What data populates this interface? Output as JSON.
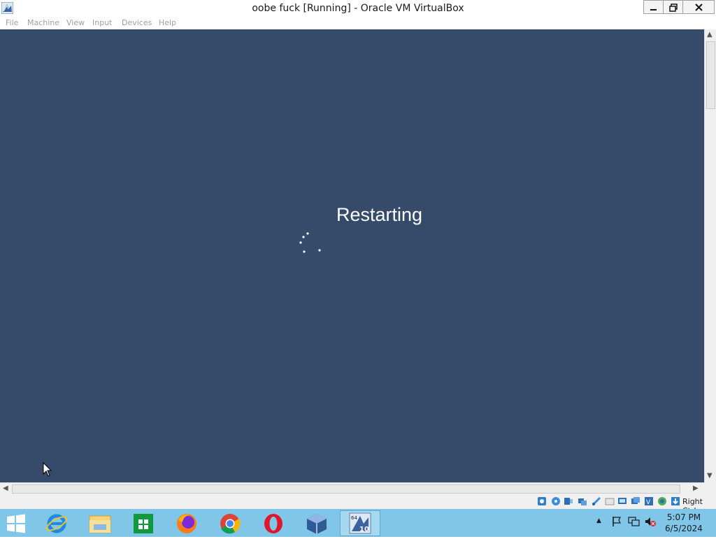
{
  "window": {
    "title": "oobe fuck [Running] - Oracle VM VirtualBox"
  },
  "menu": {
    "file": "File",
    "machine": "Machine",
    "view": "View",
    "input": "Input",
    "devices": "Devices",
    "help": "Help"
  },
  "vm": {
    "status_text": "Restarting",
    "background_color": "#354b69"
  },
  "statusbar": {
    "host_key": "Right Ctrl",
    "icons": [
      "hard-disk-icon",
      "optical-drive-icon",
      "audio-icon",
      "network-icon",
      "usb-icon",
      "shared-folders-icon",
      "display-icon",
      "video-capture-icon",
      "virtualization-icon",
      "cpu-icon",
      "mouse-integration-icon",
      "keyboard-icon"
    ]
  },
  "taskbar": {
    "color": "#7fc6e9",
    "apps": [
      "internet-explorer-icon",
      "file-explorer-icon",
      "store-icon",
      "firefox-icon",
      "chrome-icon",
      "opera-icon",
      "virtualbox-icon",
      "virtualbox-vm-icon"
    ],
    "vm_badge_top": "64",
    "vm_badge_num": "10",
    "clock_time": "5:07 PM",
    "clock_date": "6/5/2024"
  }
}
